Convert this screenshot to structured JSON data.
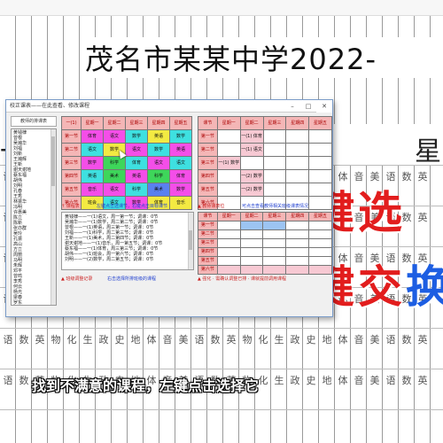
{
  "document": {
    "title": "茂名市某某中学2022-",
    "header_glyphs": [
      "一",
      "星"
    ],
    "column_glyphs": [
      "语",
      "数",
      "英",
      "物",
      "化",
      "生",
      "政",
      "史",
      "地",
      "体",
      "音",
      "美",
      "语",
      "数",
      "英",
      "物",
      "化",
      "生",
      "政",
      "史",
      "地",
      "体",
      "音",
      "美",
      "语",
      "数",
      "英"
    ]
  },
  "overlay": {
    "line1_red": "左键选",
    "line2_red": "右键交",
    "line2_blue": "换"
  },
  "caption": "找到不满意的课程，左键点击选择它",
  "window": {
    "title": "校正课表——在此查看、修改课程",
    "controls": {
      "minimize": "–",
      "maximize": "□",
      "close": "✕"
    }
  },
  "left_panel": {
    "label": "教师的排课表",
    "teachers": [
      "黄钱棣",
      "曾根",
      "吴瀚华",
      "刘福",
      "刘新",
      "王瀚辉",
      "王新",
      "谢天谢地",
      "蔡东福",
      "胡伟",
      "刘明",
      "孔春",
      "王秀",
      "林振华",
      "冯明",
      "许惠美",
      "陈立",
      "陈新",
      "张亦群",
      "吴玲",
      "孔振",
      "高山",
      "方立",
      "周丽",
      "马明",
      "朱辉",
      "邓平",
      "曾鸣",
      "李秀",
      "何云",
      "杨光",
      "梁春",
      "罗东"
    ]
  },
  "class_grid": {
    "corner": "一(1)",
    "days": [
      "星期一",
      "星期二",
      "星期三",
      "星期四",
      "星期五"
    ],
    "periods": [
      "第一节",
      "第二节",
      "第三节",
      "第四节",
      "第五节",
      "第六节"
    ],
    "cells": [
      [
        {
          "t": "体育",
          "c": "magenta"
        },
        {
          "t": "语文",
          "c": "magenta"
        },
        {
          "t": "数学",
          "c": "cyan"
        },
        {
          "t": "英语",
          "c": "yellow"
        },
        {
          "t": "数学",
          "c": "cyan"
        }
      ],
      [
        {
          "t": "语文",
          "c": "cyan"
        },
        {
          "t": "数学",
          "c": "yellow"
        },
        {
          "t": "语文",
          "c": "magenta"
        },
        {
          "t": "数学",
          "c": "cyan"
        },
        {
          "t": "英语",
          "c": "magenta"
        }
      ],
      [
        {
          "t": "数学",
          "c": "magenta"
        },
        {
          "t": "科学",
          "c": "green"
        },
        {
          "t": "体育",
          "c": "cyan"
        },
        {
          "t": "语文",
          "c": "magenta"
        },
        {
          "t": "语文",
          "c": "cyan"
        }
      ],
      [
        {
          "t": "英语",
          "c": "cyan"
        },
        {
          "t": "美术",
          "c": "green"
        },
        {
          "t": "英语",
          "c": "magenta"
        },
        {
          "t": "科学",
          "c": "green"
        },
        {
          "t": "体育",
          "c": "magenta"
        }
      ],
      [
        {
          "t": "音乐",
          "c": "magenta"
        },
        {
          "t": "语文",
          "c": "magenta"
        },
        {
          "t": "科学",
          "c": "cyan"
        },
        {
          "t": "美术",
          "c": "blue"
        },
        {
          "t": "数学",
          "c": "magenta"
        }
      ],
      [
        {
          "t": "班会",
          "c": "yellow"
        },
        {
          "t": "语文",
          "c": "cyan"
        },
        {
          "t": "数学",
          "c": "magenta"
        },
        {
          "t": "体育",
          "c": "yellow"
        },
        {
          "t": "音乐",
          "c": "yellow"
        }
      ]
    ]
  },
  "teacher_grid": {
    "corner": "课节",
    "days": [
      "星期一",
      "星期二",
      "星期三",
      "星期四",
      "星期五"
    ],
    "periods": [
      "第一节",
      "第二节",
      "第三节",
      "第四节",
      "第五节",
      "第六节"
    ],
    "cells": [
      [
        "",
        "一(1) 体育",
        "",
        "",
        ""
      ],
      [
        "",
        "一(1) 语文",
        "",
        "",
        ""
      ],
      [
        "一(1) 数学",
        "",
        "",
        "",
        ""
      ],
      [
        "",
        "一(2) 数学",
        "",
        "",
        ""
      ],
      [
        "",
        "一(2) 数学",
        "",
        "",
        ""
      ],
      [
        "",
        "",
        "",
        "",
        ""
      ]
    ]
  },
  "free_grid": {
    "corner": "课节",
    "days": [
      "星期一",
      "星期二",
      "星期三",
      "星期四",
      "星期五"
    ],
    "periods": [
      "第一节",
      "第二节",
      "第三节",
      "第四节",
      "第五节",
      "第六节"
    ]
  },
  "status": {
    "left_top": "↑ 课程表",
    "mid_top": "左键点击选课节，右键点击目标课节",
    "right_top": "▲ 教师课表位",
    "right_top2": "可点击查看教师相关班级课表情况",
    "left_bottom": "▲ 班级调整记录",
    "mid_bottom": "右击选择所排班级的课程",
    "right_bottom": "▲ 强化  · 需确认调整已排 · 课就提前调用课程"
  },
  "log": [
    "黄钱棣——一(1)语文，周一第一节；调课：0节",
    "吴瀚华——一(1)数学，周二第二节；调课：0节",
    "曾根——一(1)英语，周三第一节；调课：0节",
    "刘福——一(1)科学，周二第三节；调课：0节",
    "王新——一(1)美术，周二第四节；调课：0节",
    "谢天谢地——一(1)音乐，周一第五节；调课：0节",
    "蔡东福——一(1)体育，周三第三节；调课：0节",
    "胡伟——一(1)班会，周一第六节；调课：0节",
    "刘明——一(2)数学，周二第五节；调课：0节"
  ]
}
